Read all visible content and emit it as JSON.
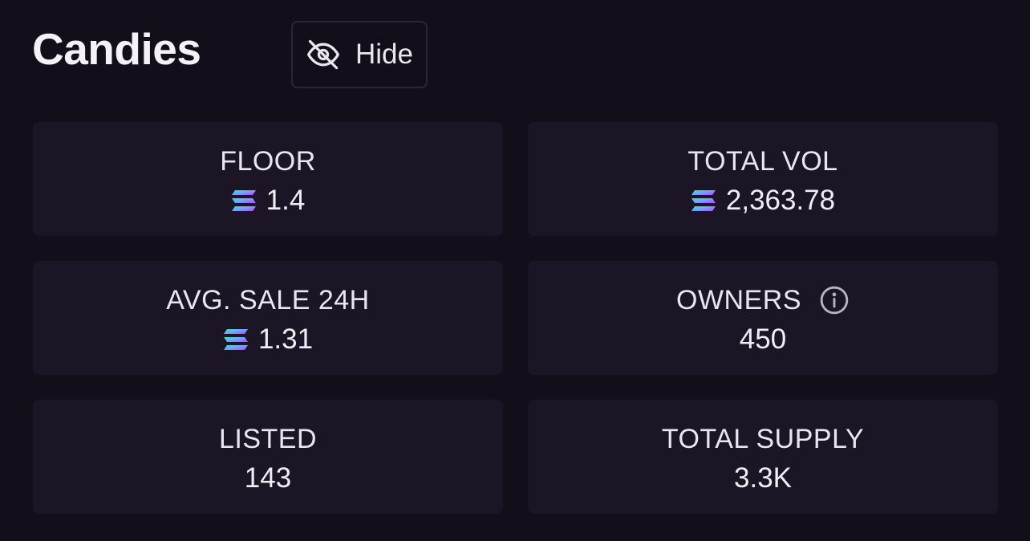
{
  "header": {
    "title": "Candies",
    "hide_button": {
      "label": "Hide",
      "icon": "eye-off-icon"
    }
  },
  "stats": {
    "floor": {
      "label": "FLOOR",
      "value": "1.4",
      "icon": "solana-icon"
    },
    "total_vol": {
      "label": "TOTAL VOL",
      "value": "2,363.78",
      "icon": "solana-icon"
    },
    "avg_sale": {
      "label": "AVG. SALE 24H",
      "value": "1.31",
      "icon": "solana-icon"
    },
    "owners": {
      "label": "OWNERS",
      "value": "450",
      "icon": "info-icon"
    },
    "listed": {
      "label": "LISTED",
      "value": "143"
    },
    "total_supply": {
      "label": "TOTAL SUPPLY",
      "value": "3.3K"
    }
  },
  "colors": {
    "background": "#120e1a",
    "card": "#1c1526",
    "solana_gradient": [
      "#00ffa3",
      "#03e1ff",
      "#dc1fff"
    ]
  }
}
